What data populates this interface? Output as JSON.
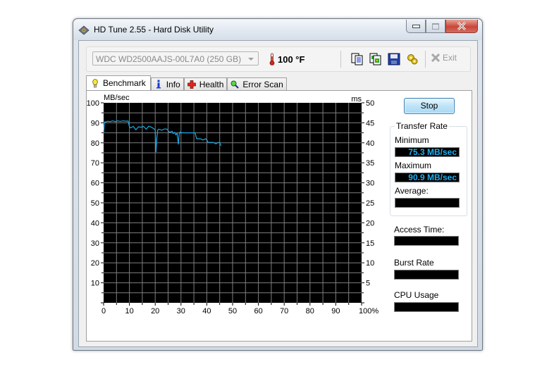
{
  "window": {
    "title": "HD Tune 2.55 - Hard Disk Utility",
    "buttons": {
      "minimize": "minimize",
      "maximize": "maximize",
      "close": "close"
    }
  },
  "toolbar": {
    "drive": "WDC WD2500AAJS-00L7A0 (250 GB)",
    "temperature": "100 °F",
    "icons": [
      "copy-text-icon",
      "copy-screenshot-icon",
      "save-icon",
      "options-icon"
    ],
    "exit_label": "Exit"
  },
  "tabs": [
    {
      "label": "Benchmark",
      "icon": "lightbulb-icon",
      "active": true
    },
    {
      "label": "Info",
      "icon": "info-icon",
      "active": false
    },
    {
      "label": "Health",
      "icon": "health-cross-icon",
      "active": false
    },
    {
      "label": "Error Scan",
      "icon": "magnifier-icon",
      "active": false
    }
  ],
  "controls": {
    "stop_label": "Stop",
    "transfer_rate_title": "Transfer Rate",
    "minimum_label": "Minimum",
    "minimum_value": "75.3 MB/sec",
    "maximum_label": "Maximum",
    "maximum_value": "90.9 MB/sec",
    "average_label": "Average:",
    "average_value": "",
    "access_time_label": "Access Time:",
    "access_time_value": "",
    "burst_rate_label": "Burst Rate",
    "burst_rate_value": "",
    "cpu_usage_label": "CPU Usage",
    "cpu_usage_value": ""
  },
  "colors": {
    "series": "#1ba8e6",
    "plot_bg": "#000000",
    "grid": "#7f7f7f",
    "value_text": "#1bb0f0"
  },
  "chart_data": {
    "type": "line",
    "title": "",
    "xlabel": "%",
    "ylabel": "MB/sec",
    "y2label": "ms",
    "xlim": [
      0,
      100
    ],
    "ylim": [
      0,
      100
    ],
    "y2lim": [
      0,
      50
    ],
    "x_ticks": [
      "0",
      "10",
      "20",
      "30",
      "40",
      "50",
      "60",
      "70",
      "80",
      "90",
      "100%"
    ],
    "y_ticks": [
      "10",
      "20",
      "30",
      "40",
      "50",
      "60",
      "70",
      "80",
      "90",
      "100"
    ],
    "y2_ticks": [
      "5",
      "10",
      "15",
      "20",
      "25",
      "30",
      "35",
      "40",
      "45",
      "50"
    ],
    "grid": true,
    "series": [
      {
        "name": "Transfer Rate",
        "x": [
          0,
          0.4,
          0.8,
          1.5,
          2.5,
          3.5,
          4.5,
          5.5,
          6.5,
          7.5,
          8.5,
          9.5,
          10.0,
          10.5,
          11.5,
          12.5,
          13.5,
          14.5,
          15.5,
          16.5,
          17.5,
          18.5,
          19.5,
          20.0,
          20.3,
          20.6,
          21.0,
          21.5,
          22.5,
          23.5,
          24.5,
          25.5,
          26.5,
          27.0,
          27.5,
          28.0,
          28.5,
          29.0,
          29.3,
          29.6,
          30.0,
          30.5,
          31.5,
          32.5,
          33.5,
          34.5,
          35.5,
          36.0,
          36.5,
          37.5,
          38.5,
          39.5,
          40.0,
          40.5,
          41.5,
          42.5,
          43.5,
          44.5,
          45.0,
          45.5
        ],
        "values": [
          85,
          90.5,
          90.3,
          90.8,
          90.6,
          91.0,
          90.6,
          91.0,
          90.7,
          91.0,
          90.8,
          90.9,
          88.0,
          87.5,
          88.2,
          86.5,
          88.0,
          87.8,
          88.2,
          86.8,
          88.3,
          87.8,
          87.0,
          86.5,
          75.3,
          82.0,
          86.5,
          86.8,
          86.3,
          86.9,
          86.9,
          85.2,
          85.8,
          84.6,
          85.2,
          84.0,
          84.8,
          79.2,
          84.2,
          85.4,
          84.9,
          85.1,
          85.0,
          85.0,
          85.0,
          85.0,
          85.0,
          82.2,
          82.0,
          82.0,
          81.4,
          82.0,
          81.5,
          80.2,
          80.2,
          80.2,
          79.5,
          80.2,
          80.2,
          78.5
        ]
      }
    ]
  }
}
